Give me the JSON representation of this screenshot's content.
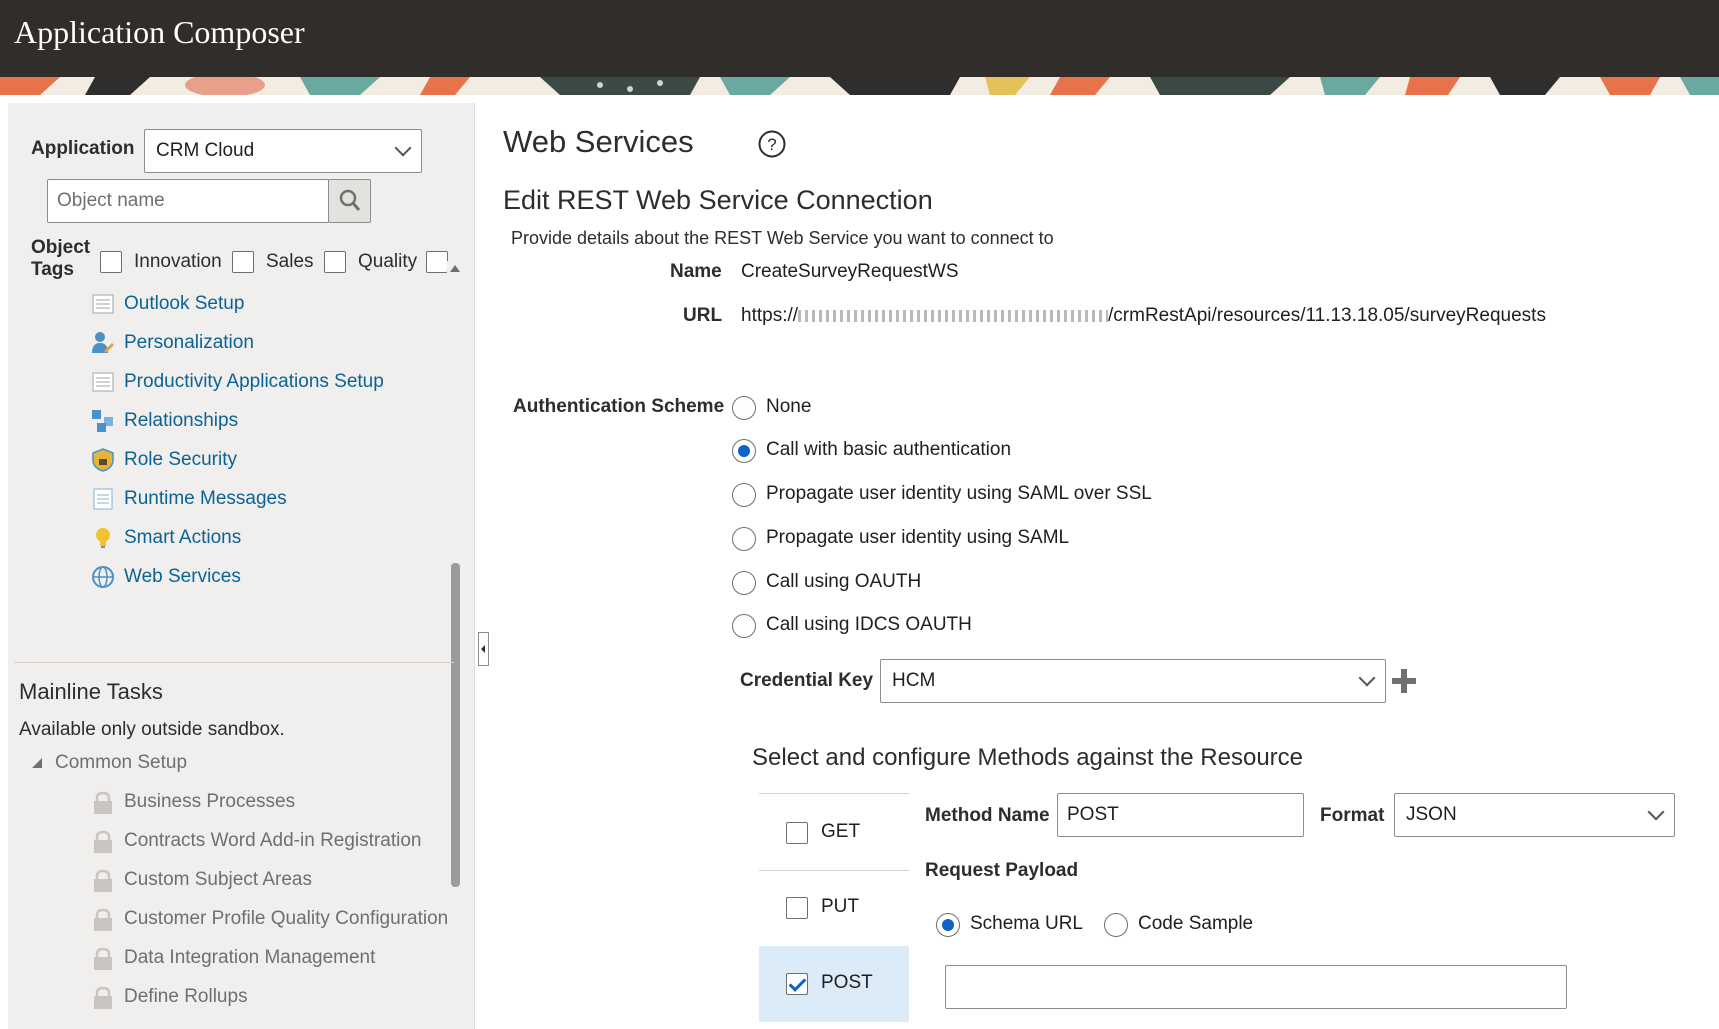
{
  "app": {
    "title": "Application Composer"
  },
  "sidebar": {
    "application_label": "Application",
    "application_value": "CRM Cloud",
    "search_placeholder": "Object name",
    "object_tags_label_1": "Object",
    "object_tags_label_2": "Tags",
    "tags": [
      "Innovation",
      "Sales",
      "Quality"
    ],
    "nav_items": [
      {
        "label": "Outlook Setup",
        "icon": "document-icon"
      },
      {
        "label": "Personalization",
        "icon": "personalization-icon"
      },
      {
        "label": "Productivity Applications Setup",
        "icon": "document-icon"
      },
      {
        "label": "Relationships",
        "icon": "relationships-icon"
      },
      {
        "label": "Role Security",
        "icon": "shield-icon"
      },
      {
        "label": "Runtime Messages",
        "icon": "list-icon"
      },
      {
        "label": "Smart Actions",
        "icon": "lightbulb-icon"
      },
      {
        "label": "Web Services",
        "icon": "globe-icon"
      }
    ],
    "mainline_title": "Mainline Tasks",
    "mainline_note": "Available only outside sandbox.",
    "common_setup": "Common Setup",
    "tasks": [
      "Business Processes",
      "Contracts Word Add-in Registration",
      "Custom Subject Areas",
      "Customer Profile Quality Configuration",
      "Data Integration Management",
      "Define Rollups"
    ]
  },
  "main": {
    "page_title": "Web Services",
    "section_title": "Edit REST Web Service Connection",
    "description": "Provide details about the REST Web Service you want to connect to",
    "name_label": "Name",
    "name_value": "CreateSurveyRequestWS",
    "url_label": "URL",
    "url_prefix": "https://",
    "url_suffix": "/crmRestApi/resources/11.13.18.05/surveyRequests",
    "auth_label": "Authentication Scheme",
    "auth_options": [
      "None",
      "Call with basic authentication",
      "Propagate user identity using SAML over SSL",
      "Propagate user identity using SAML",
      "Call using OAUTH",
      "Call using IDCS OAUTH"
    ],
    "auth_selected": "Call with basic authentication",
    "credential_label": "Credential Key",
    "credential_value": "HCM",
    "methods_title": "Select and configure Methods against the Resource",
    "methods": [
      {
        "label": "GET",
        "checked": false
      },
      {
        "label": "PUT",
        "checked": false
      },
      {
        "label": "POST",
        "checked": true
      }
    ],
    "method_name_label": "Method Name",
    "method_name_value": "POST",
    "format_label": "Format",
    "format_value": "JSON",
    "request_payload_label": "Request Payload",
    "payload_options": [
      "Schema URL",
      "Code Sample"
    ],
    "payload_selected": "Schema URL",
    "schema_url_value": ""
  }
}
